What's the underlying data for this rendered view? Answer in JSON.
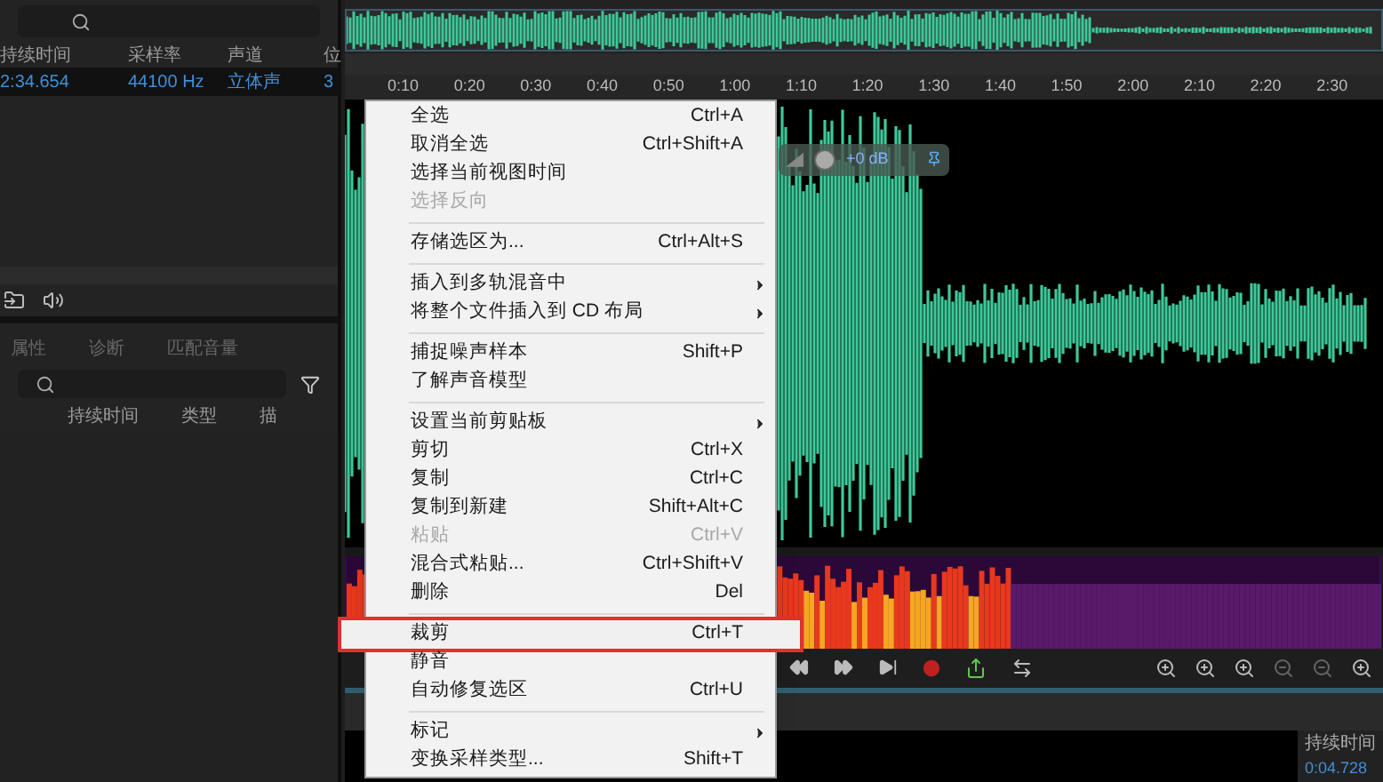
{
  "files_panel": {
    "columns": [
      "持续时间",
      "采样率",
      "声道",
      "位"
    ],
    "rows": [
      {
        "cells": [
          "2:34.654",
          "44100 Hz",
          "立体声",
          "3"
        ],
        "selected": true
      }
    ]
  },
  "lower_panel": {
    "tabs": [
      {
        "label": "属性",
        "selected": false
      },
      {
        "label": "诊断",
        "selected": false
      },
      {
        "label": "匹配音量",
        "selected": false
      }
    ],
    "columns": [
      "持续时间",
      "类型",
      "描"
    ]
  },
  "editor": {
    "ruler": [
      "0:10",
      "0:20",
      "0:30",
      "0:40",
      "0:50",
      "1:00",
      "1:10",
      "1:20",
      "1:30",
      "1:40",
      "1:50",
      "2:00",
      "2:10",
      "2:20",
      "2:30"
    ],
    "hud_gain": "+0 dB",
    "duration_label": "持续时间",
    "duration_value": "0:04.728"
  },
  "context_menu": [
    {
      "kind": "item",
      "label": "全选",
      "shortcut": "Ctrl+A",
      "disabled": false,
      "submenu": false,
      "highlighted": false
    },
    {
      "kind": "item",
      "label": "取消全选",
      "shortcut": "Ctrl+Shift+A",
      "disabled": false,
      "submenu": false,
      "highlighted": false
    },
    {
      "kind": "item",
      "label": "选择当前视图时间",
      "disabled": false,
      "submenu": false,
      "highlighted": false
    },
    {
      "kind": "item",
      "label": "选择反向",
      "disabled": true,
      "submenu": false,
      "highlighted": false
    },
    {
      "kind": "separator"
    },
    {
      "kind": "item",
      "label": "存储选区为...",
      "shortcut": "Ctrl+Alt+S",
      "disabled": false,
      "submenu": false,
      "highlighted": false
    },
    {
      "kind": "separator"
    },
    {
      "kind": "item",
      "label": "插入到多轨混音中",
      "disabled": false,
      "submenu": true,
      "highlighted": false
    },
    {
      "kind": "item",
      "label": "将整个文件插入到 CD 布局",
      "disabled": false,
      "submenu": true,
      "highlighted": false
    },
    {
      "kind": "separator"
    },
    {
      "kind": "item",
      "label": "捕捉噪声样本",
      "shortcut": "Shift+P",
      "disabled": false,
      "submenu": false,
      "highlighted": false
    },
    {
      "kind": "item",
      "label": "了解声音模型",
      "disabled": false,
      "submenu": false,
      "highlighted": false
    },
    {
      "kind": "separator"
    },
    {
      "kind": "item",
      "label": "设置当前剪贴板",
      "disabled": false,
      "submenu": true,
      "highlighted": false
    },
    {
      "kind": "item",
      "label": "剪切",
      "shortcut": "Ctrl+X",
      "disabled": false,
      "submenu": false,
      "highlighted": false
    },
    {
      "kind": "item",
      "label": "复制",
      "shortcut": "Ctrl+C",
      "disabled": false,
      "submenu": false,
      "highlighted": false
    },
    {
      "kind": "item",
      "label": "复制到新建",
      "shortcut": "Shift+Alt+C",
      "disabled": false,
      "submenu": false,
      "highlighted": false
    },
    {
      "kind": "item",
      "label": "粘贴",
      "shortcut": "Ctrl+V",
      "disabled": true,
      "submenu": false,
      "highlighted": false
    },
    {
      "kind": "item",
      "label": "混合式粘贴...",
      "shortcut": "Ctrl+Shift+V",
      "disabled": false,
      "submenu": false,
      "highlighted": false
    },
    {
      "kind": "item",
      "label": "删除",
      "shortcut": "Del",
      "disabled": false,
      "submenu": false,
      "highlighted": false
    },
    {
      "kind": "separator"
    },
    {
      "kind": "item",
      "label": "裁剪",
      "shortcut": "Ctrl+T",
      "disabled": false,
      "submenu": false,
      "highlighted": true
    },
    {
      "kind": "item",
      "label": "静音",
      "disabled": false,
      "submenu": false,
      "highlighted": false
    },
    {
      "kind": "item",
      "label": "自动修复选区",
      "shortcut": "Ctrl+U",
      "disabled": false,
      "submenu": false,
      "highlighted": false
    },
    {
      "kind": "separator"
    },
    {
      "kind": "item",
      "label": "标记",
      "disabled": false,
      "submenu": true,
      "highlighted": false
    },
    {
      "kind": "item",
      "label": "变换采样类型...",
      "shortcut": "Shift+T",
      "disabled": false,
      "submenu": false,
      "highlighted": false
    }
  ]
}
